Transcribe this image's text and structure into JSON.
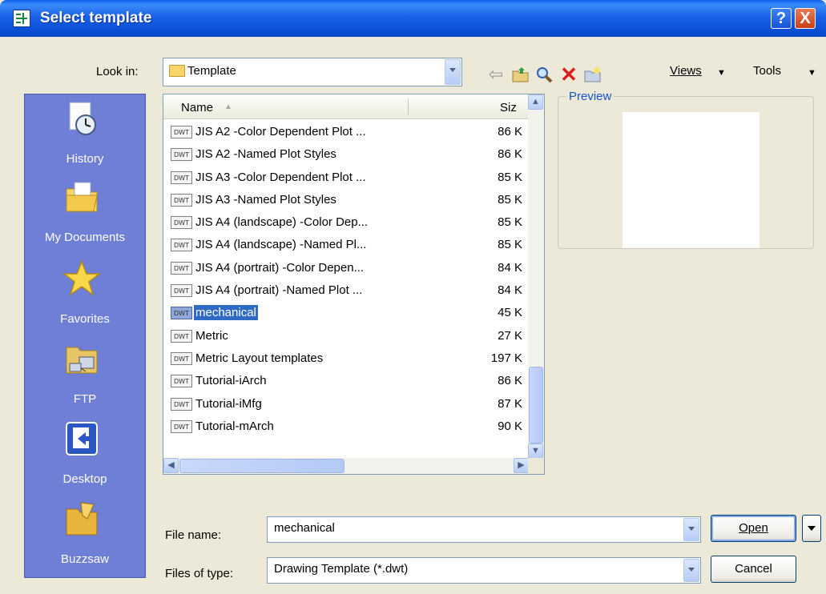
{
  "window": {
    "title": "Select template",
    "help": "?",
    "close": "X"
  },
  "toolbar": {
    "look_in_label": "Look in:",
    "look_in_value": "Template",
    "views_label": "Views",
    "tools_label": "Tools"
  },
  "places": [
    "History",
    "My Documents",
    "Favorites",
    "FTP",
    "Desktop",
    "Buzzsaw"
  ],
  "list": {
    "col_name": "Name",
    "col_size": "Siz",
    "icon_text": "DWT",
    "files": [
      {
        "name": "JIS A2 -Color Dependent Plot ...",
        "size": "86 K"
      },
      {
        "name": "JIS A2 -Named Plot Styles",
        "size": "86 K"
      },
      {
        "name": "JIS A3 -Color Dependent Plot ...",
        "size": "85 K"
      },
      {
        "name": "JIS A3 -Named Plot Styles",
        "size": "85 K"
      },
      {
        "name": "JIS A4 (landscape) -Color Dep...",
        "size": "85 K"
      },
      {
        "name": "JIS A4 (landscape) -Named Pl...",
        "size": "85 K"
      },
      {
        "name": "JIS A4 (portrait) -Color Depen...",
        "size": "84 K"
      },
      {
        "name": "JIS A4 (portrait) -Named Plot ...",
        "size": "84 K"
      },
      {
        "name": "mechanical",
        "size": "45 K"
      },
      {
        "name": "Metric",
        "size": "27 K"
      },
      {
        "name": "Metric Layout templates",
        "size": "197 K"
      },
      {
        "name": "Tutorial-iArch",
        "size": "86 K"
      },
      {
        "name": "Tutorial-iMfg",
        "size": "87 K"
      },
      {
        "name": "Tutorial-mArch",
        "size": "90 K"
      }
    ]
  },
  "preview": {
    "title": "Preview"
  },
  "filename": {
    "label": "File name:",
    "value": "mechanical"
  },
  "filetype": {
    "label": "Files of type:",
    "value": "Drawing Template (*.dwt)"
  },
  "buttons": {
    "open": "Open",
    "cancel": "Cancel"
  }
}
